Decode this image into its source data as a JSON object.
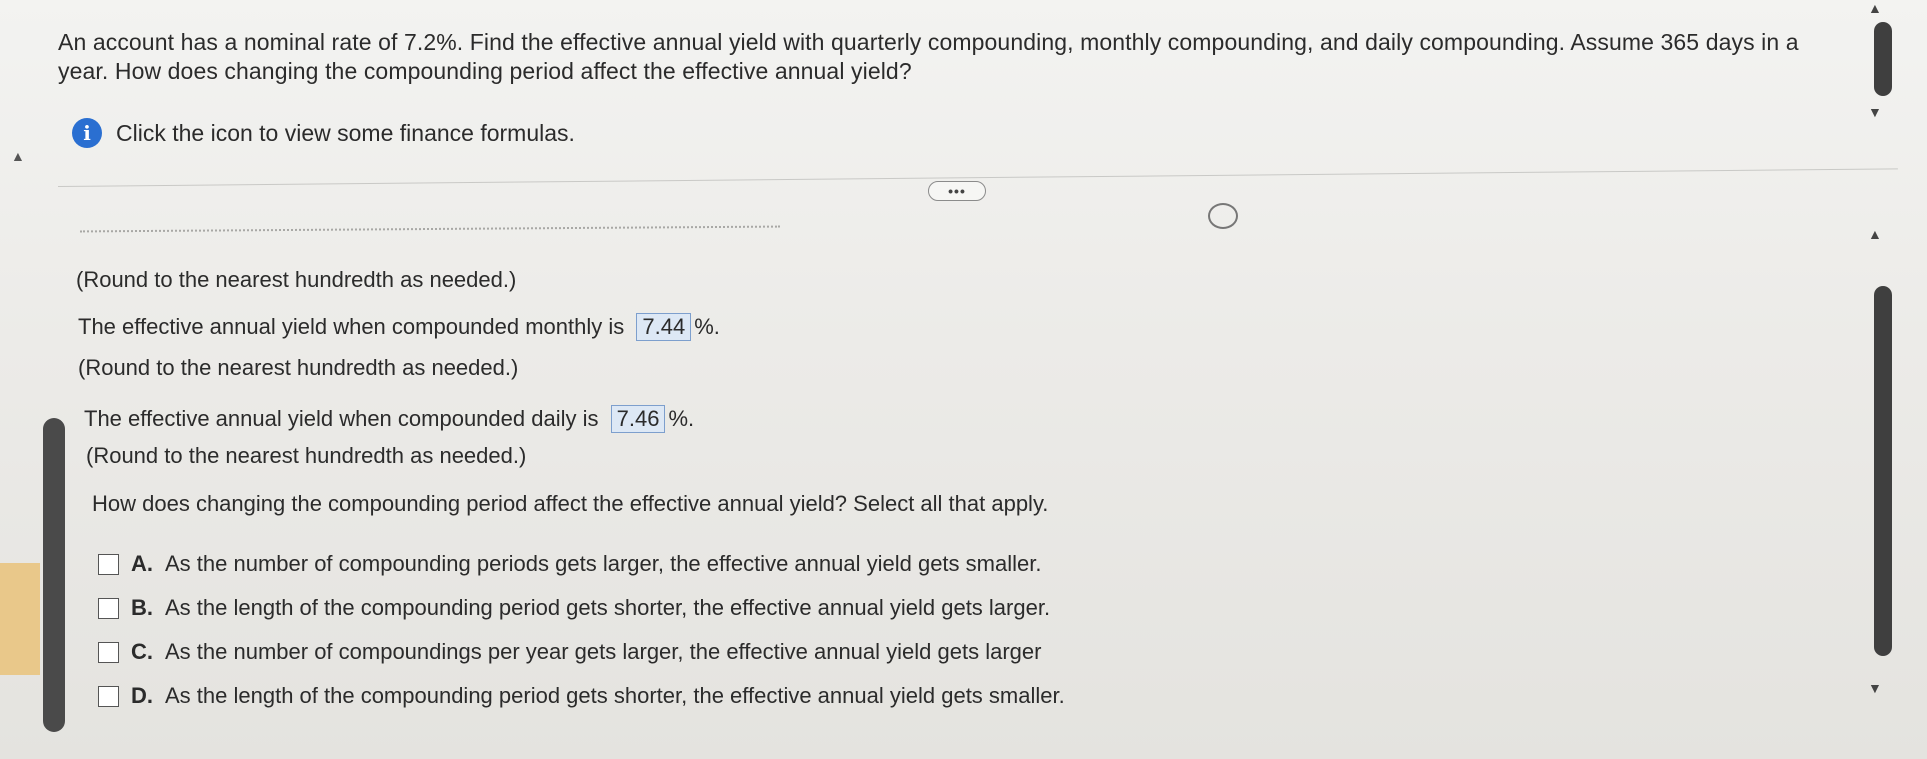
{
  "question": "An account has a nominal rate of 7.2%. Find the effective annual yield with quarterly compounding, monthly compounding, and daily compounding. Assume 365 days in a year. How does changing the compounding period affect the effective annual yield?",
  "info": {
    "icon": "info-icon",
    "text": "Click the icon to view some finance formulas."
  },
  "more_button": "•••",
  "round_note": "(Round to the nearest hundredth as needed.)",
  "monthly": {
    "label": "The effective annual yield when compounded monthly is",
    "value": "7.44",
    "unit": "%.",
    "note": "(Round to the nearest hundredth as needed.)"
  },
  "daily": {
    "label": "The effective annual yield when compounded daily is",
    "value": "7.46",
    "unit": "%.",
    "note": "(Round to the nearest hundredth as needed.)"
  },
  "prompt": "How does changing the compounding period affect the effective annual yield? Select all that apply.",
  "options": [
    {
      "letter": "A.",
      "text": "As the number of compounding periods gets larger, the effective annual yield gets smaller."
    },
    {
      "letter": "B.",
      "text": "As the length of the compounding period gets shorter, the effective annual yield gets larger."
    },
    {
      "letter": "C.",
      "text": "As the number of compoundings per year gets larger, the effective annual yield gets larger"
    },
    {
      "letter": "D.",
      "text": "As the length of the compounding period gets shorter, the effective annual yield gets smaller."
    }
  ]
}
